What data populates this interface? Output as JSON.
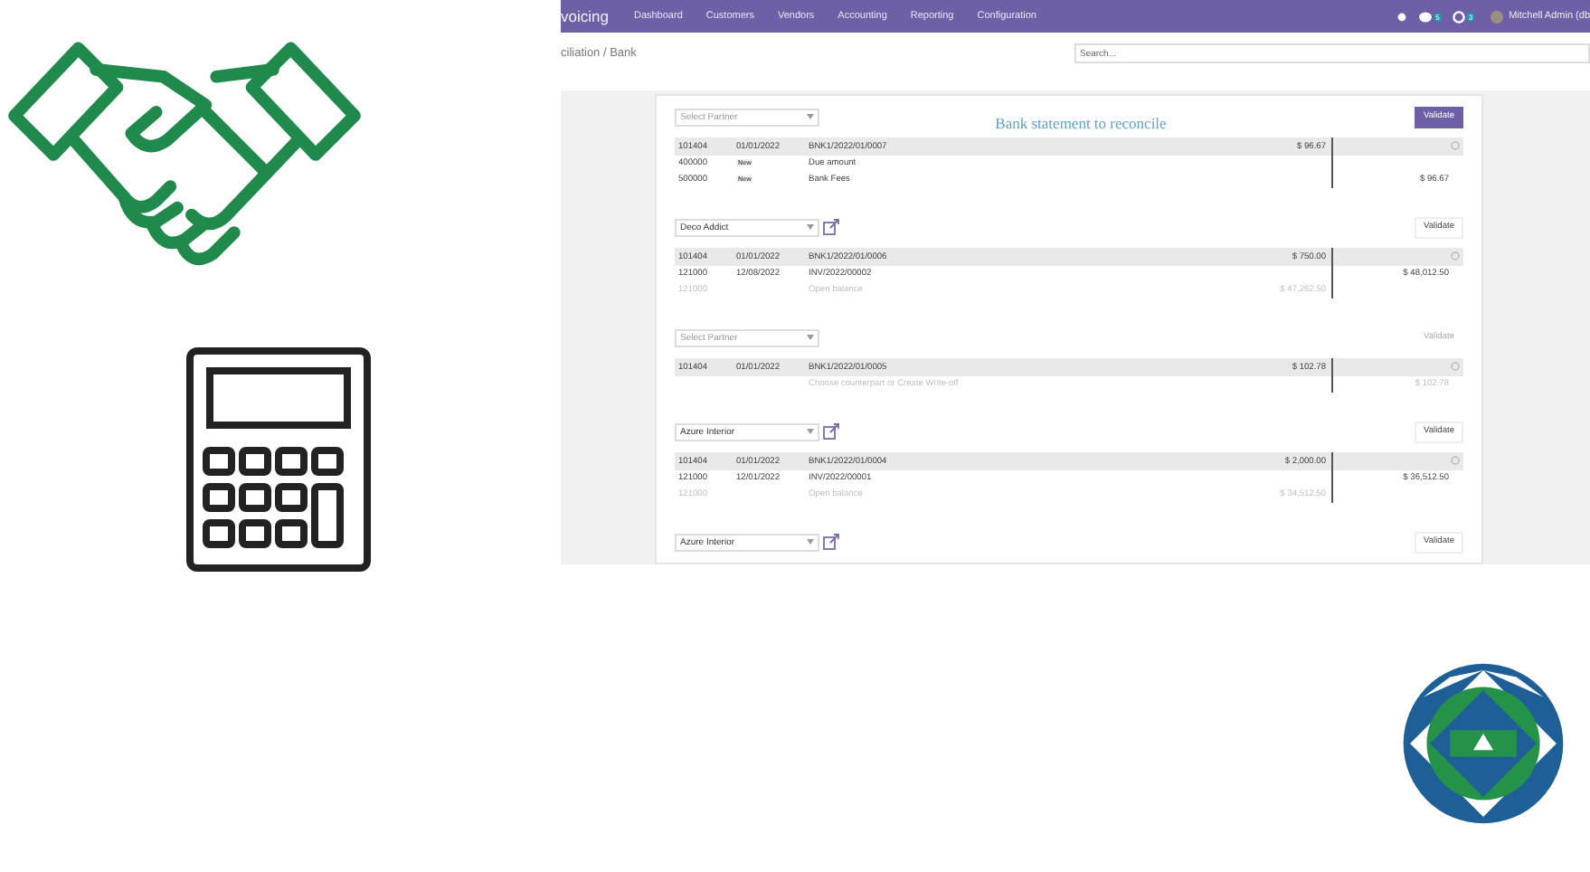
{
  "app_screen": {
    "navbar": {
      "app_name": "voicing",
      "menu": [
        "Dashboard",
        "Customers",
        "Vendors",
        "Accounting",
        "Reporting",
        "Configuration"
      ],
      "chat_count": "5",
      "activity_count": "3",
      "user": "Mitchell Admin (db"
    },
    "breadcrumb": "ciliation / Bank",
    "search": {
      "placeholder": "Search..."
    },
    "blocks": [
      {
        "partner": {
          "placeholder": "Select Partner"
        },
        "has_link": false,
        "title": "Bank statement to reconcile",
        "validate": {
          "label": "Validate",
          "kind": "primary"
        },
        "rows": [
          {
            "kind": "statement",
            "cells": [
              "101404",
              "01/01/2022",
              "BNK1/2022/01/0007",
              "$ 96.67",
              ""
            ]
          },
          {
            "kind": "line",
            "badge": "New",
            "cells": [
              "400000",
              "",
              "Due amount",
              "",
              ""
            ]
          },
          {
            "kind": "line",
            "badge": "New",
            "cells": [
              "500000",
              "",
              "Bank Fees",
              "",
              "$ 96.67"
            ]
          }
        ]
      },
      {
        "partner": {
          "value": "Deco Addict"
        },
        "has_link": true,
        "validate": {
          "label": "Validate",
          "kind": "default"
        },
        "rows": [
          {
            "kind": "statement",
            "cells": [
              "101404",
              "01/01/2022",
              "BNK1/2022/01/0006",
              "$ 750.00",
              ""
            ]
          },
          {
            "kind": "line",
            "cells": [
              "121000",
              "12/08/2022",
              "INV/2022/00002",
              "",
              "$ 48,012.50"
            ]
          },
          {
            "kind": "muted",
            "cells": [
              "121000",
              "",
              "Open balance",
              "$ 47,262.50",
              ""
            ]
          }
        ]
      },
      {
        "partner": {
          "placeholder": "Select Partner"
        },
        "has_link": false,
        "validate": {
          "label": "Validate",
          "kind": "disabled"
        },
        "rows": [
          {
            "kind": "statement",
            "cells": [
              "101404",
              "01/01/2022",
              "BNK1/2022/01/0005",
              "$ 102.78",
              ""
            ]
          },
          {
            "kind": "muted",
            "cells": [
              "",
              "",
              "Choose counterpart or Create Write-off",
              "",
              "$ 102.78"
            ]
          }
        ]
      },
      {
        "partner": {
          "value": "Azure Interior"
        },
        "has_link": true,
        "validate": {
          "label": "Validate",
          "kind": "default"
        },
        "rows": [
          {
            "kind": "statement",
            "cells": [
              "101404",
              "01/01/2022",
              "BNK1/2022/01/0004",
              "$ 2,000.00",
              ""
            ]
          },
          {
            "kind": "line",
            "cells": [
              "121000",
              "12/01/2022",
              "INV/2022/00001",
              "",
              "$ 36,512.50"
            ]
          },
          {
            "kind": "muted",
            "cells": [
              "121000",
              "",
              "Open balance",
              "$ 34,512.50",
              ""
            ]
          }
        ]
      },
      {
        "partner": {
          "value": "Azure Interior"
        },
        "has_link": true,
        "validate": {
          "label": "Validate",
          "kind": "default"
        }
      }
    ]
  }
}
